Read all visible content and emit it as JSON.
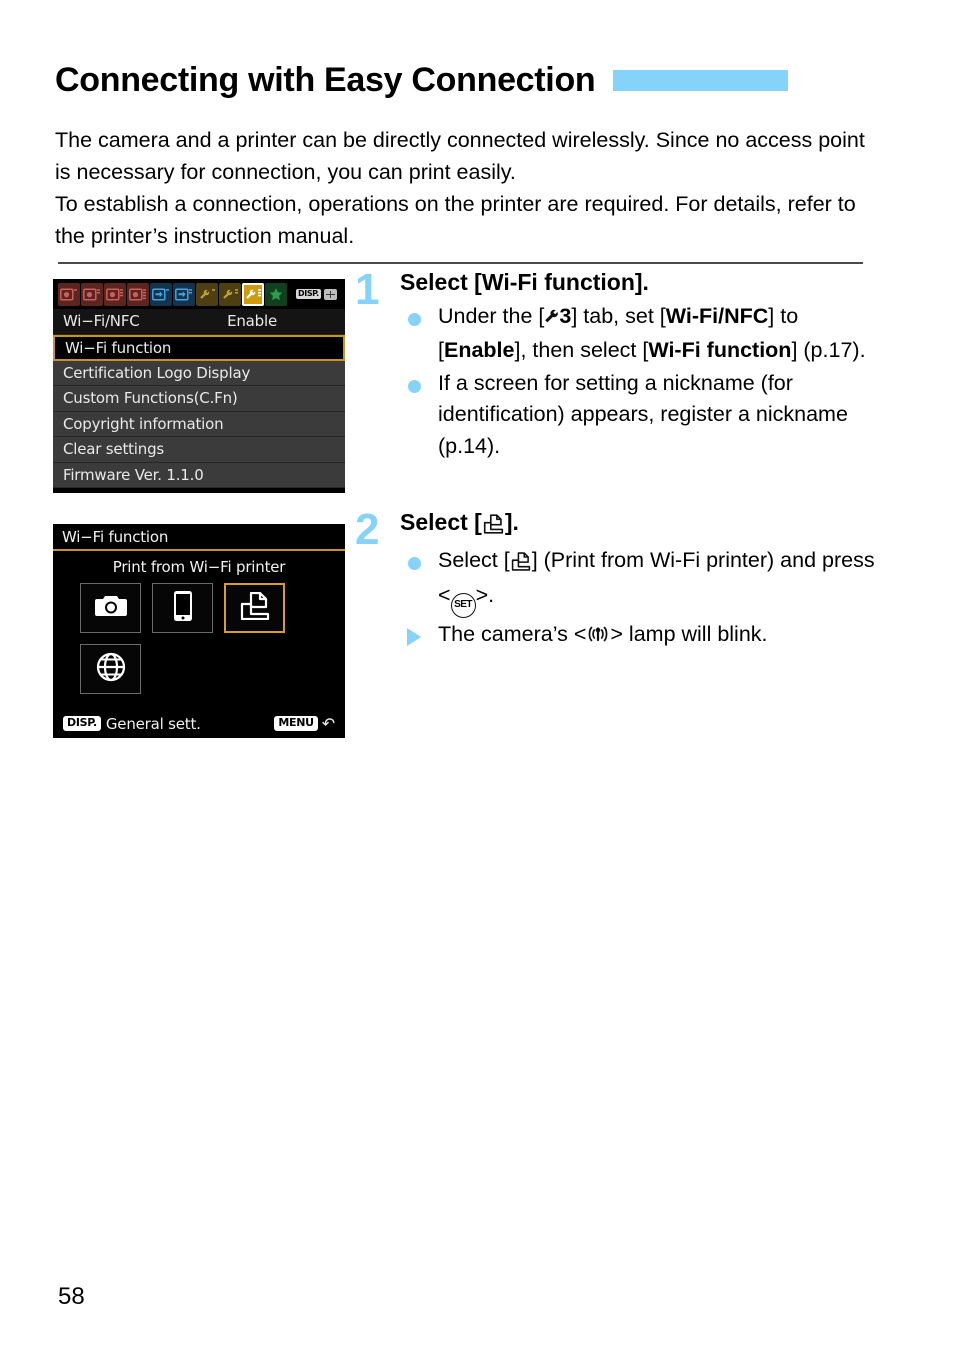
{
  "page": {
    "title": "Connecting with Easy Connection",
    "page_number": "58",
    "accent_color": "#85d3fa",
    "intro": [
      "The camera and a printer can be directly connected wirelessly. Since no access point is necessary for connection, you can print easily.",
      "To establish a connection, operations on the printer are required. For details, refer to the printer’s instruction manual."
    ]
  },
  "screens": {
    "menu": {
      "tabs": [
        {
          "name": "shooting-1",
          "color": "red",
          "active": false
        },
        {
          "name": "shooting-2",
          "color": "red",
          "active": false
        },
        {
          "name": "shooting-3",
          "color": "red",
          "active": false
        },
        {
          "name": "shooting-4",
          "color": "red",
          "active": false
        },
        {
          "name": "playback-1",
          "color": "blue",
          "active": false
        },
        {
          "name": "playback-2",
          "color": "blue",
          "active": false
        },
        {
          "name": "setup-1",
          "color": "yellow",
          "active": false
        },
        {
          "name": "setup-2",
          "color": "yellow",
          "active": false
        },
        {
          "name": "setup-3",
          "color": "yellow",
          "active": true
        },
        {
          "name": "my-menu",
          "color": "green",
          "active": false
        }
      ],
      "disp_badge": "DISP.",
      "rows": [
        {
          "label": "Wi−Fi/NFC",
          "value": "Enable",
          "selected": false,
          "top": true
        },
        {
          "label": "Wi−Fi function",
          "value": "",
          "selected": true,
          "top": false
        },
        {
          "label": "Certification Logo Display",
          "value": "",
          "selected": false,
          "top": false
        },
        {
          "label": "Custom Functions(C.Fn)",
          "value": "",
          "selected": false,
          "top": false
        },
        {
          "label": "Copyright information",
          "value": "",
          "selected": false,
          "top": false
        },
        {
          "label": "Clear settings",
          "value": "",
          "selected": false,
          "top": false
        },
        {
          "label": "Firmware Ver. 1.1.0",
          "value": "",
          "selected": false,
          "top": false
        }
      ]
    },
    "wifi": {
      "header": "Wi−Fi function",
      "subtitle": "Print from Wi−Fi printer",
      "options": [
        {
          "icon": "camera-icon",
          "selected": false
        },
        {
          "icon": "smartphone-icon",
          "selected": false
        },
        {
          "icon": "printer-icon",
          "selected": true
        },
        {
          "icon": "globe-icon",
          "selected": false
        }
      ],
      "footer_disp_badge": "DISP.",
      "footer_disp_label": "General sett.",
      "footer_menu_badge": "MENU",
      "footer_menu_glyph": "↶"
    }
  },
  "steps": [
    {
      "number": "1",
      "heading": "Select [Wi-Fi function].",
      "bullets": [
        {
          "marker": "dot",
          "parts": [
            {
              "t": "Under the [",
              "bold": false
            },
            {
              "t": "ƒ",
              "bold": true,
              "icon": "wrench-icon"
            },
            {
              "t": "3",
              "bold": true
            },
            {
              "t": "] tab, set [",
              "bold": false
            },
            {
              "t": "Wi-Fi/NFC",
              "bold": true
            },
            {
              "t": "] to [",
              "bold": false
            },
            {
              "t": "Enable",
              "bold": true
            },
            {
              "t": "], then select [",
              "bold": false
            },
            {
              "t": "Wi-Fi function",
              "bold": true
            },
            {
              "t": "] (p.17).",
              "bold": false
            }
          ]
        },
        {
          "marker": "dot",
          "parts": [
            {
              "t": "If a screen for setting a nickname (for identification) appears, register a nickname (p.14).",
              "bold": false
            }
          ]
        }
      ]
    },
    {
      "number": "2",
      "heading": "Select [⧉].",
      "heading_icon": "printer-icon",
      "bullets": [
        {
          "marker": "dot",
          "parts": [
            {
              "t": "Select [",
              "bold": false
            },
            {
              "t": "⧉",
              "bold": false,
              "icon": "printer-icon"
            },
            {
              "t": "] (Print from Wi-Fi printer) and press <",
              "bold": false
            },
            {
              "t": "SET",
              "bold": false,
              "icon": "set-button-icon"
            },
            {
              "t": ">.",
              "bold": false
            }
          ]
        },
        {
          "marker": "triangle",
          "parts": [
            {
              "t": "The camera’s <",
              "bold": false
            },
            {
              "t": "((↑))",
              "bold": false,
              "icon": "wifi-lamp-icon"
            },
            {
              "t": "> lamp will blink.",
              "bold": false
            }
          ]
        }
      ]
    }
  ]
}
